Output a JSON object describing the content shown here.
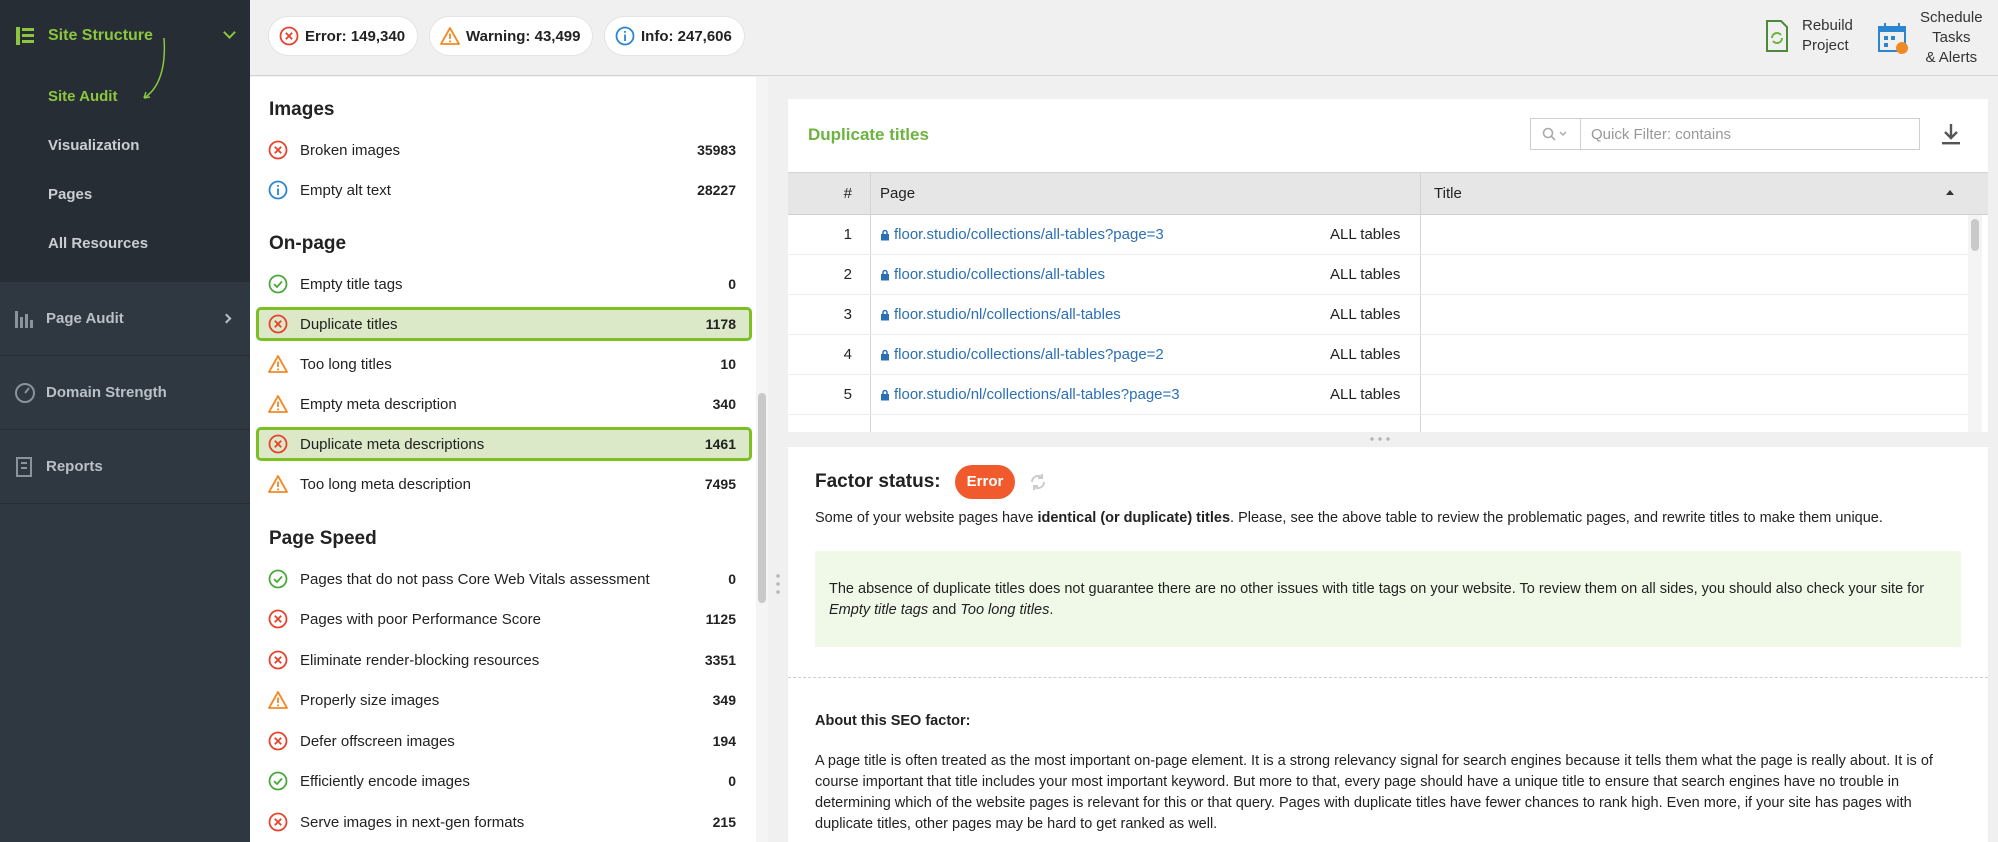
{
  "sidebar": {
    "header_label": "Site Structure",
    "sub_items": [
      {
        "label": "Site Audit"
      },
      {
        "label": "Visualization"
      },
      {
        "label": "Pages"
      },
      {
        "label": "All Resources"
      }
    ],
    "items": [
      {
        "label": "Page Audit",
        "icon": "bar-chart-icon"
      },
      {
        "label": "Domain Strength",
        "icon": "gauge-icon"
      },
      {
        "label": "Reports",
        "icon": "report-icon"
      }
    ]
  },
  "topbar": {
    "error_label": "Error: 149,340",
    "warning_label": "Warning: 43,499",
    "info_label": "Info: 247,606",
    "rebuild_line1": "Rebuild",
    "rebuild_line2": "Project",
    "schedule_line1": "Schedule",
    "schedule_line2": "Tasks",
    "schedule_line3": "& Alerts"
  },
  "issues": {
    "sections": [
      {
        "title": "Images",
        "items": [
          {
            "name": "Broken images",
            "count": "35983",
            "status": "error"
          },
          {
            "name": "Empty alt text",
            "count": "28227",
            "status": "info"
          }
        ]
      },
      {
        "title": "On-page",
        "items": [
          {
            "name": "Empty title tags",
            "count": "0",
            "status": "ok"
          },
          {
            "name": "Duplicate titles",
            "count": "1178",
            "status": "error"
          },
          {
            "name": "Too long titles",
            "count": "10",
            "status": "warning"
          },
          {
            "name": "Empty meta description",
            "count": "340",
            "status": "warning"
          },
          {
            "name": "Duplicate meta descriptions",
            "count": "1461",
            "status": "error"
          },
          {
            "name": "Too long meta description",
            "count": "7495",
            "status": "warning"
          }
        ]
      },
      {
        "title": "Page Speed",
        "items": [
          {
            "name": "Pages that do not pass Core Web Vitals assessment",
            "count": "0",
            "status": "ok"
          },
          {
            "name": "Pages with poor Performance Score",
            "count": "1125",
            "status": "error"
          },
          {
            "name": "Eliminate render-blocking resources",
            "count": "3351",
            "status": "error"
          },
          {
            "name": "Properly size images",
            "count": "349",
            "status": "warning"
          },
          {
            "name": "Defer offscreen images",
            "count": "194",
            "status": "error"
          },
          {
            "name": "Efficiently encode images",
            "count": "0",
            "status": "ok"
          },
          {
            "name": "Serve images in next-gen formats",
            "count": "215",
            "status": "error"
          }
        ]
      }
    ]
  },
  "details": {
    "title": "Duplicate titles",
    "filter_placeholder": "Quick Filter: contains",
    "columns": {
      "num": "#",
      "page": "Page",
      "title": "Title"
    },
    "rows": [
      {
        "num": "1",
        "page": "floor.studio/collections/all-tables?page=3",
        "title": "ALL tables"
      },
      {
        "num": "2",
        "page": "floor.studio/collections/all-tables",
        "title": "ALL tables"
      },
      {
        "num": "3",
        "page": "floor.studio/nl/collections/all-tables",
        "title": "ALL tables"
      },
      {
        "num": "4",
        "page": "floor.studio/collections/all-tables?page=2",
        "title": "ALL tables"
      },
      {
        "num": "5",
        "page": "floor.studio/nl/collections/all-tables?page=3",
        "title": "ALL tables"
      }
    ],
    "factor_label": "Factor status:",
    "factor_status": "Error",
    "desc_before": "Some of your website pages have ",
    "desc_bold": "identical (or duplicate) titles",
    "desc_after": ". Please, see the above table to review the problematic pages, and rewrite titles to make them unique.",
    "tip_before": "The absence of duplicate titles does not guarantee there are no other issues with title tags on your website. To review them on all sides, you should also check your site for ",
    "tip_link1": "Empty title tags",
    "tip_mid": " and ",
    "tip_link2": "Too long titles",
    "tip_end": ".",
    "about_title": "About this SEO factor:",
    "about_text": "A page title is often treated as the most important on-page element. It is a strong relevancy signal for search engines because it tells them what the page is really about. It is of course important that title includes your most important keyword. But more to that, every page should have a unique title to ensure that search engines have no trouble in determining which of the website pages is relevant for this or that query. Pages with duplicate titles have fewer chances to rank high. Even more, if your site has pages with duplicate titles, other pages may be hard to get ranked as well."
  },
  "colors": {
    "accent_green": "#8cc63f",
    "error_red": "#e8412c",
    "warning_orange": "#f08a24",
    "info_blue": "#2b86cf",
    "ok_green": "#4aa83a"
  }
}
